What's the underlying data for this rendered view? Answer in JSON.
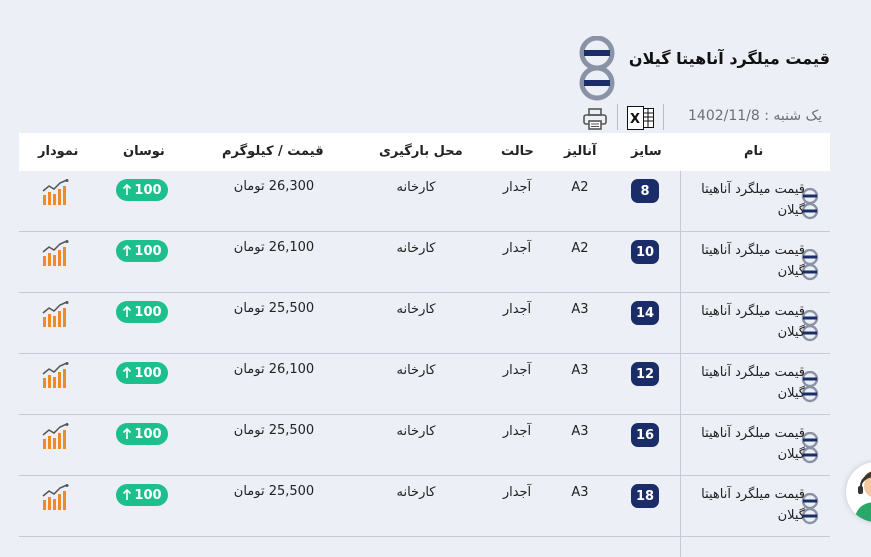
{
  "header": {
    "title": "قیمت میلگرد آناهیتا گیلان",
    "date": "یک شنبه : 1402/11/8"
  },
  "table": {
    "columns": {
      "name": "نام",
      "size": "سایز",
      "analysis": "آنالیز",
      "state": "حالت",
      "place": "محل بارگیری",
      "price": "قیمت / کیلوگرم",
      "fluctuation": "نوسان",
      "chart": "نمودار"
    },
    "rows": [
      {
        "name": "قیمت میلگرد آناهیتا گیلان",
        "size": "8",
        "analysis": "A2",
        "state": "آجدار",
        "place": "کارخانه",
        "price": "26,300 تومان",
        "fluctuation": "100"
      },
      {
        "name": "قیمت میلگرد آناهیتا گیلان",
        "size": "10",
        "analysis": "A2",
        "state": "آجدار",
        "place": "کارخانه",
        "price": "26,100 تومان",
        "fluctuation": "100"
      },
      {
        "name": "قیمت میلگرد آناهیتا گیلان",
        "size": "14",
        "analysis": "A3",
        "state": "آجدار",
        "place": "کارخانه",
        "price": "25,500 تومان",
        "fluctuation": "100"
      },
      {
        "name": "قیمت میلگرد آناهیتا گیلان",
        "size": "12",
        "analysis": "A3",
        "state": "آجدار",
        "place": "کارخانه",
        "price": "26,100 تومان",
        "fluctuation": "100"
      },
      {
        "name": "قیمت میلگرد آناهیتا گیلان",
        "size": "16",
        "analysis": "A3",
        "state": "آجدار",
        "place": "کارخانه",
        "price": "25,500 تومان",
        "fluctuation": "100"
      },
      {
        "name": "قیمت میلگرد آناهیتا گیلان",
        "size": "18",
        "analysis": "A3",
        "state": "آجدار",
        "place": "کارخانه",
        "price": "25,500 تومان",
        "fluctuation": "100"
      }
    ]
  },
  "icons": {
    "logo": "brand-logo-icon",
    "excel": "excel-icon",
    "print": "print-icon",
    "chart": "chart-icon",
    "fluctuation_up": "arrow-up-icon",
    "support": "support-avatar"
  },
  "colors": {
    "background": "#eceff5",
    "size_badge": "#1b2d68",
    "fluctuation_badge": "#1dbf8c",
    "chart_icon": "#f08a24"
  }
}
